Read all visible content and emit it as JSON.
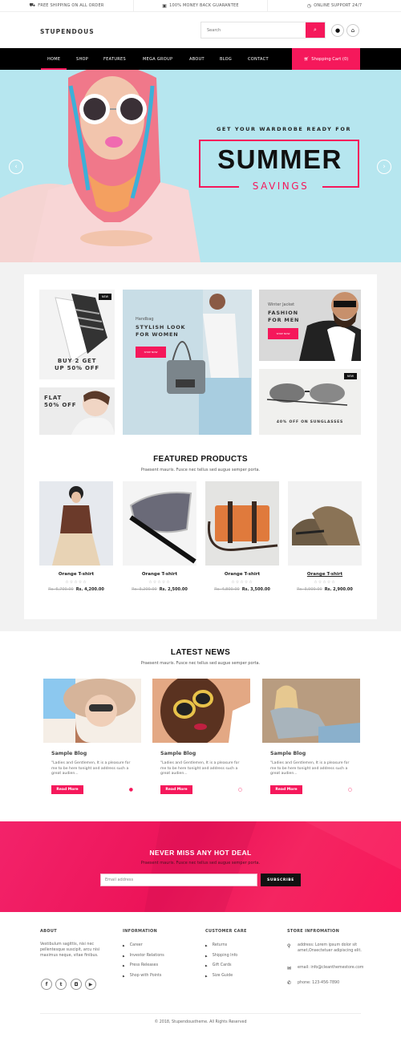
{
  "topbar": {
    "items": [
      {
        "icon": "truck-icon",
        "label": "FREE SHIPPING ON ALL ORDER"
      },
      {
        "icon": "money-icon",
        "label": "100% MONEY BACK GUARANTEE"
      },
      {
        "icon": "clock-icon",
        "label": "ONLINE SUPPORT 24/7"
      }
    ]
  },
  "header": {
    "logo": "STUPENDOUS",
    "search_placeholder": "Search",
    "icons": [
      "search-icon",
      "user-icon",
      "basket-icon"
    ]
  },
  "nav": {
    "items": [
      "HOME",
      "SHOP",
      "FEATURES",
      "MEGA GROUP",
      "ABOUT",
      "BLOG",
      "CONTACT"
    ],
    "active": "HOME",
    "cart_label": "Shopping Cart (0)"
  },
  "hero": {
    "tagline": "GET YOUR WARDROBE READY FOR",
    "headline": "SUMMER",
    "subheadline": "SAVINGS",
    "background": "#b6e6ef",
    "accent": "#f5185b"
  },
  "banners": {
    "shoes": {
      "badge": "NEW",
      "text": [
        "BUY 2 GET",
        "UP 50% OFF"
      ]
    },
    "flat": {
      "text": [
        "FLAT",
        "50% OFF"
      ]
    },
    "handbag": {
      "category": "Handbag",
      "text": [
        "STYLISH LOOK",
        "FOR WOMEN"
      ],
      "button": "SHOP NOW"
    },
    "jacket": {
      "category": "Winter Jacket",
      "text": [
        "FASHION",
        "FOR MEN"
      ],
      "button": "SHOP NOW"
    },
    "sunglasses": {
      "badge": "NEW",
      "text": "40% OFF ON SUNGLASSES"
    }
  },
  "featured": {
    "title": "FEATURED PRODUCTS",
    "subtitle": "Praesent mauris. Fusce nec tellus sed augue semper porta.",
    "products": [
      {
        "name": "Orange T-shirt",
        "rating": 0,
        "old_price": "Rs. 6,700.00",
        "price": "Rs. 4,200.00"
      },
      {
        "name": "Orange T-shirt",
        "rating": 0,
        "old_price": "Rs. 3,200.00",
        "price": "Rs. 2,500.00"
      },
      {
        "name": "Orange T-shirt",
        "rating": 0,
        "old_price": "Rs. 4,800.00",
        "price": "Rs. 3,500.00"
      },
      {
        "name": "Orange T-shirt",
        "rating": 0,
        "old_price": "Rs. 3,900.00",
        "price": "Rs. 2,900.00"
      }
    ]
  },
  "news": {
    "title": "LATEST NEWS",
    "subtitle": "Praesent mauris. Fusce nec tellus sed augue semper porta.",
    "posts": [
      {
        "title": "Sample Blog",
        "excerpt": "\"Ladies and Gentlemen, It is a pleasure for me to be here tonight and address such a great audien...",
        "button": "Read More"
      },
      {
        "title": "Sample Blog",
        "excerpt": "\"Ladies and Gentlemen, It is a pleasure for me to be here tonight and address such a great audien...",
        "button": "Read More"
      },
      {
        "title": "Sample Blog",
        "excerpt": "\"Ladies and Gentlemen, It is a pleasure for me to be here tonight and address such a great audien...",
        "button": "Read More"
      }
    ]
  },
  "newsletter": {
    "title": "NEVER MISS ANY HOT DEAL",
    "subtitle": "Praesent mauris. Fusce nec tellus sed augue semper porta.",
    "placeholder": "Email address",
    "button": "SUBSCRIBE"
  },
  "footer": {
    "about": {
      "title": "ABOUT",
      "text": "Vestibulum sagittis, nisi nec pellentesque suscipit, arcu nisi maximus neque, vitae finibus.",
      "social": [
        "f",
        "t",
        "ig",
        "yt"
      ]
    },
    "information": {
      "title": "INFORMATION",
      "links": [
        "Career",
        "Investor Relations",
        "Press Releases",
        "Shop with Points"
      ]
    },
    "customer_care": {
      "title": "CUSTOMER CARE",
      "links": [
        "Returns",
        "Shipping Info",
        "Gift Cards",
        "Size Guide"
      ]
    },
    "store": {
      "title": "STORE INFROMATION",
      "address": "address: Lorem ipsum dolor sit amet,Onsectetuer adipiscing elit.",
      "email": "email: info@cleanthemestore.com",
      "phone": "phone: 123-456-7890"
    },
    "copyright": "© 2018, Stupendoustheme. All Rights Reserved"
  }
}
